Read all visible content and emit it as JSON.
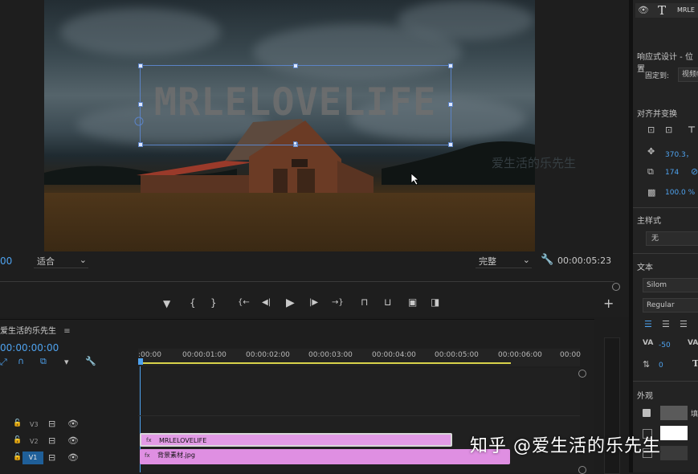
{
  "monitor": {
    "overlay_text": "MRLELOVELIFE",
    "watermark_faint": "爱生活的乐先生",
    "timecode_left": "00",
    "zoom_select": "适合",
    "quality_select": "完整",
    "duration": "00:00:05:23"
  },
  "transport": {
    "marker": "▼",
    "in_point": "{",
    "out_point": "}",
    "goto_in": "{←",
    "step_back": "◀|",
    "play": "▶",
    "step_forward": "|▶",
    "goto_out": "→}",
    "lift": "⊓",
    "extract": "⊔",
    "camera": "▣",
    "compare": "◨",
    "add": "+"
  },
  "timeline": {
    "sequence_name": "爱生活的乐先生",
    "menu_icon": "≡",
    "timecode": "00:00:00:00",
    "ruler": [
      ":00:00",
      "00:00:01:00",
      "00:00:02:00",
      "00:00:03:00",
      "00:00:04:00",
      "00:00:05:00",
      "00:00:06:00",
      "00:00"
    ],
    "tracks": [
      {
        "name": "V3"
      },
      {
        "name": "V2"
      },
      {
        "name": "V1"
      }
    ],
    "clips": [
      {
        "label": "MRLELOVELIFE",
        "badge": "fx"
      },
      {
        "label": "背景素材.jpg",
        "badge": "fx"
      }
    ]
  },
  "essential_graphics": {
    "layer_name": "MRLE",
    "responsive_section": "响应式设计 - 位置",
    "pin_to_label": "固定到:",
    "pin_to_value": "视频帧",
    "align_section": "对齐并变换",
    "position_value": "370.3，",
    "rotation_value": "174",
    "opacity_value": "100.0 %",
    "master_style_section": "主样式",
    "master_style_value": "无",
    "text_section": "文本",
    "font_value": "Silom",
    "font_style_value": "Regular",
    "kerning_value": "-50",
    "leading_value": "0",
    "appearance_section": "外观",
    "fill_label": "填"
  },
  "watermark": "知乎 @爱生活的乐先生"
}
